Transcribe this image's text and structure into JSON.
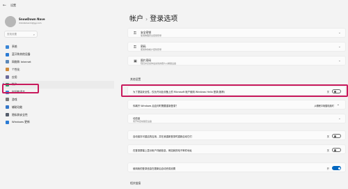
{
  "window": {
    "back_glyph": "←",
    "title": "设置"
  },
  "user": {
    "name": "SnowDown Nave",
    "email": "dnbnbnlanm@gy.com"
  },
  "search": {
    "placeholder": "查找设置",
    "icon": "search-icon"
  },
  "nav": [
    {
      "label": "系统",
      "icon": "system-icon",
      "color": "#3a86d6",
      "active": false
    },
    {
      "label": "蓝牙和其他设备",
      "icon": "bluetooth-icon",
      "color": "#2b7bd4",
      "active": false
    },
    {
      "label": "网络和 Internet",
      "icon": "network-icon",
      "color": "#5b88b8",
      "active": false
    },
    {
      "label": "个性化",
      "icon": "personalization-icon",
      "color": "#d08a3a",
      "active": false
    },
    {
      "label": "应用",
      "icon": "apps-icon",
      "color": "#6a6a9a",
      "active": false
    },
    {
      "label": "帐户",
      "icon": "accounts-icon",
      "color": "#2f9e6e",
      "active": true
    },
    {
      "label": "时间和语言",
      "icon": "time-language-icon",
      "color": "#3a86d6",
      "active": false
    },
    {
      "label": "游戏",
      "icon": "gaming-icon",
      "color": "#7a7a7a",
      "active": false
    },
    {
      "label": "辅助功能",
      "icon": "accessibility-icon",
      "color": "#3477c9",
      "active": false
    },
    {
      "label": "隐私和安全性",
      "icon": "privacy-icon",
      "color": "#555d6b",
      "active": false
    },
    {
      "label": "Windows 更新",
      "icon": "update-icon",
      "color": "#2b7bd4",
      "active": false
    }
  ],
  "header": {
    "parent": "帐户",
    "separator": "›",
    "title": "登录选项"
  },
  "sign_in_cards": [
    {
      "title": "安全密钥",
      "subtitle": "使用物理安全密钥登录",
      "icon": "key-icon"
    },
    {
      "title": "密码",
      "subtitle": "使用你的帐户密码登录",
      "icon": "password-icon"
    },
    {
      "title": "图片密码",
      "subtitle": "轻扫并点击你最喜欢的照片以解锁设备",
      "icon": "picture-icon"
    }
  ],
  "other_settings_heading": "其他设置",
  "hello_row": {
    "text": "为了提高安全性，仅允许对此设备上的 Microsoft 帐户使用 Windows Hello 登录(推荐)",
    "state": "关",
    "on": false
  },
  "away_row": {
    "text": "你离开 Windows 后应何时需要重新登录？",
    "value": "从睡眠中唤醒电脑时",
    "chevron": "⌄"
  },
  "dynamic_lock": {
    "title": "动态锁",
    "subtitle": "离开时自动锁定设备"
  },
  "restart_apps_row": {
    "text": "自动保存可重启的应用，并在我重新登录时重新启动它们",
    "state": "关",
    "on": false
  },
  "lock_screen_details_row": {
    "text": "在登录屏幕上显示帐户详细信息，例如我的电子邮件地址",
    "state": "关",
    "on": false
  },
  "restart_finish_row": {
    "text": "使用我的登录信息在更新后自动完成设置",
    "state": "开",
    "on": true
  },
  "related_heading": "相关链接"
}
